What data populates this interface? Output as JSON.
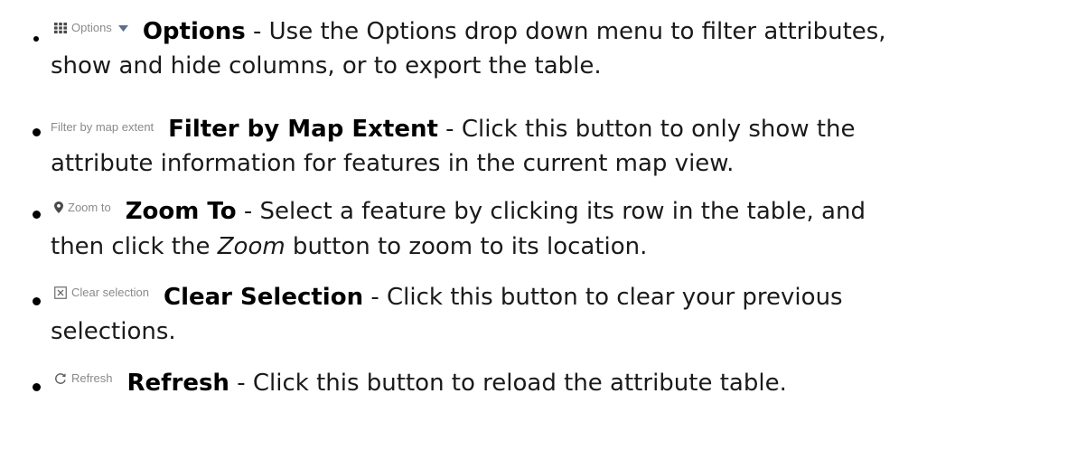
{
  "items": [
    {
      "chip_label": "Options",
      "chip_icon": "grid-icon",
      "chip_caret_icon": "caret-down-icon",
      "term": "Options",
      "text_a": " - Use the Options drop down menu to filter attributes,",
      "text_b": "show and hide columns, or to export the table."
    },
    {
      "chip_label": "Filter by map extent",
      "term": "Filter by Map Extent",
      "text_a": " - Click this button to only show the",
      "text_b": "attribute information for features in the current map view."
    },
    {
      "chip_label": "Zoom to",
      "chip_icon": "map-pin-icon",
      "term": "Zoom To",
      "text_a": " - Select a feature by clicking its row in the table, and",
      "text_b1": "then click the ",
      "text_b_em": "Zoom",
      "text_b2": " button to zoom to its location."
    },
    {
      "chip_label": "Clear selection",
      "chip_icon": "clear-selection-icon",
      "term": "Clear Selection",
      "text_a": " - Click this button to clear your previous",
      "text_b": "selections."
    },
    {
      "chip_label": "Refresh",
      "chip_icon": "refresh-icon",
      "term": "Refresh",
      "text_a": " - Click this button to reload the attribute table."
    }
  ],
  "colors": {
    "chip_text": "#8a8a8a",
    "body_text": "#1a1a1a",
    "grid_icon": "#4a4a4a",
    "caret": "#5b6f8a"
  }
}
